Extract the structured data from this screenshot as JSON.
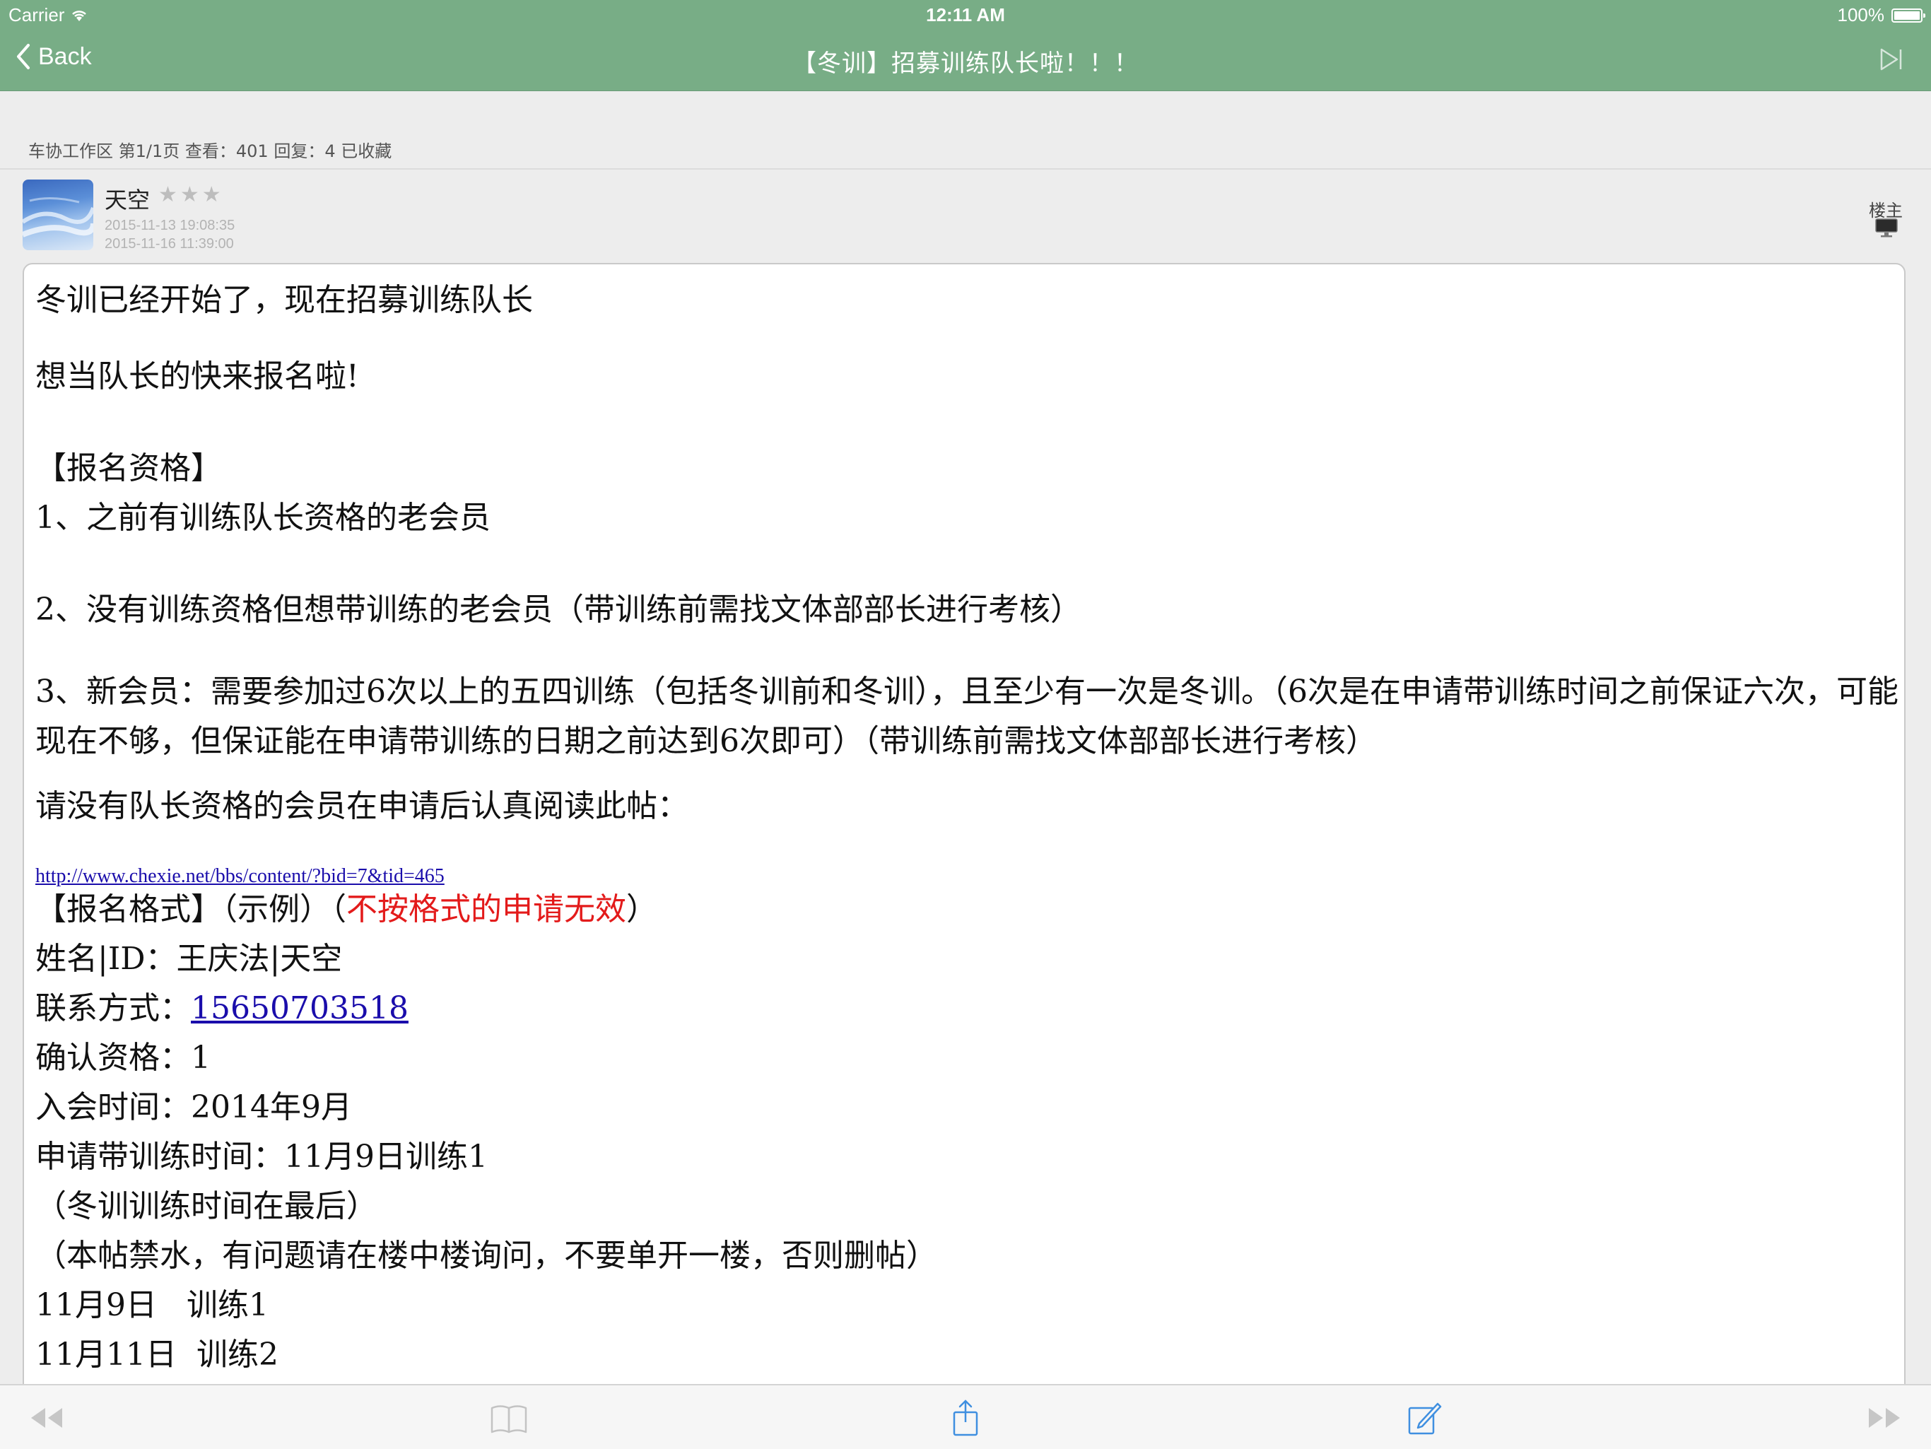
{
  "status_bar": {
    "carrier": "Carrier",
    "time": "12:11 AM",
    "battery": "100%"
  },
  "nav": {
    "back_label": "Back",
    "title": "【冬训】招募训练队长啦！！！"
  },
  "thread_info": "车协工作区 第1/1页 查看：401 回复：4 已收藏",
  "author": {
    "name": "天空",
    "stars": "★★★",
    "post_date": "2015-11-13 19:08:35",
    "edit_date": "2015-11-16 11:39:00",
    "floor_label": "楼主"
  },
  "post": {
    "line1": "冬训已经开始了，现在招募训练队长",
    "line2": "想当队长的快来报名啦!",
    "qual_heading": "【报名资格】",
    "qual1": "1、之前有训练队长资格的老会员",
    "qual2": "2、没有训练资格但想带训练的老会员（带训练前需找文体部部长进行考核）",
    "qual3": "3、新会员：需要参加过6次以上的五四训练（包括冬训前和冬训），且至少有一次是冬训。（6次是在申请带训练时间之前保证六次，可能现在不够，但保证能在申请带训练的日期之前达到6次即可）（带训练前需找文体部部长进行考核）",
    "read_notice": "请没有队长资格的会员在申请后认真阅读此帖：",
    "link_url": "http://www.chexie.net/bbs/content/?bid=7&tid=465",
    "format_heading": "【报名格式】（示例）（",
    "format_invalid": "不按格式的申请无效",
    "format_close": "）",
    "name_id": "姓名|ID：王庆法|天空",
    "contact_label": "联系方式：",
    "contact_phone": "15650703518",
    "confirm_qual": "确认资格：1",
    "join_time": "入会时间：2014年9月",
    "apply_time": "申请带训练时间：11月9日训练1",
    "note_last": "（冬训训练时间在最后）",
    "note_no_spam": "（本帖禁水，有问题请在楼中楼询问，不要单开一楼，否则删帖）",
    "session1": "11月9日   训练1",
    "session2": "11月11日  训练2"
  },
  "toolbar": {
    "prev_icon": "rewind-icon",
    "bookmark_icon": "book-icon",
    "share_icon": "share-icon",
    "compose_icon": "compose-icon",
    "next_icon": "fast-forward-icon"
  },
  "colors": {
    "nav_green": "#78ad86",
    "link_blue": "#1a0dab",
    "warning_red": "#e31b1b",
    "toolbar_blue": "#3f8fe0"
  }
}
